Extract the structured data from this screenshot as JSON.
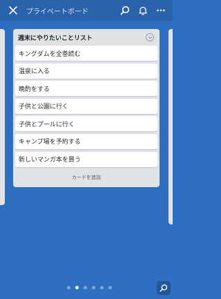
{
  "header": {
    "title": "プライベートボード",
    "close_icon": "close-icon",
    "search_icon": "search-icon",
    "notification_icon": "bell-icon",
    "menu_icon": "more-icon"
  },
  "list": {
    "title": "週末にやりたいことリスト",
    "cards": [
      {
        "label": "キングダムを全巻読む"
      },
      {
        "label": "温泉に入る"
      },
      {
        "label": "晩酌をする"
      },
      {
        "label": "子供と公園に行く"
      },
      {
        "label": "子供とプールに行く"
      },
      {
        "label": "キャンプ場を予約する"
      },
      {
        "label": "新しいマンガ本を買う"
      }
    ],
    "add_card_label": "カードを追加"
  },
  "pagination": {
    "count": 6,
    "active_index": 1
  },
  "colors": {
    "background": "#2f6fc0",
    "header": "#2a62ab",
    "list_bg": "#dfe3e8",
    "card_bg": "#ffffff"
  }
}
